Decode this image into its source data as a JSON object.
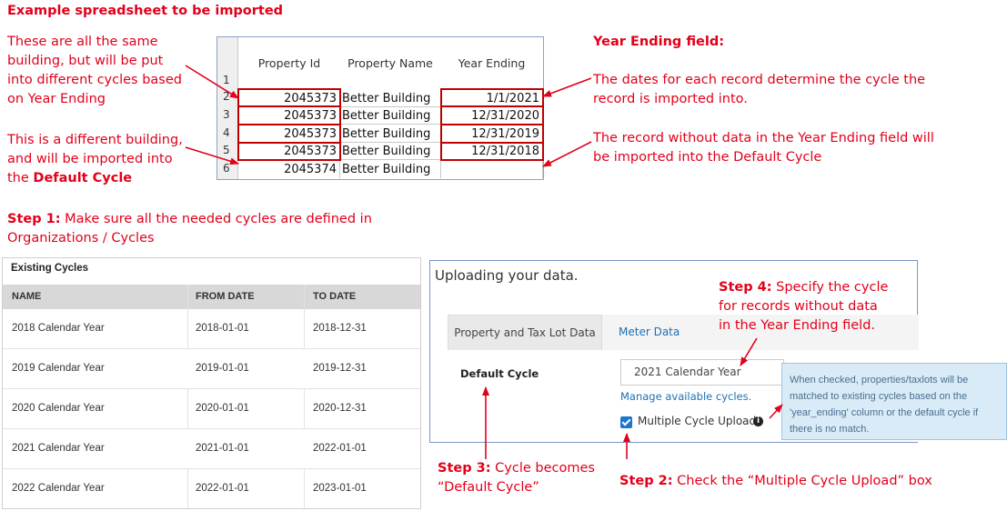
{
  "heading": "Example spreadsheet to be imported",
  "notes": {
    "same_building": [
      "These are all the same",
      "building, but will be put",
      "into different cycles based",
      "on Year Ending"
    ],
    "different_building": [
      "This is a different building,",
      "and will be imported into",
      "the "
    ],
    "different_building_bold": "Default Cycle",
    "year_ending_title": "Year Ending field:",
    "year_ending_body": [
      "The dates for each record determine the cycle the",
      "record is imported into."
    ],
    "no_data": [
      "The record without data in the Year Ending field will",
      "be imported into the Default Cycle"
    ]
  },
  "sheet": {
    "headers": [
      "Property Id",
      "Property Name",
      "Year Ending"
    ],
    "row_numbers": [
      "1",
      "2",
      "3",
      "4",
      "5",
      "6"
    ],
    "rows": [
      {
        "id": "2045373",
        "name": "Better Building",
        "year": "1/1/2021"
      },
      {
        "id": "2045373",
        "name": "Better Building",
        "year": "12/31/2020"
      },
      {
        "id": "2045373",
        "name": "Better Building",
        "year": "12/31/2019"
      },
      {
        "id": "2045373",
        "name": "Better Building",
        "year": "12/31/2018"
      },
      {
        "id": "2045374",
        "name": "Better Building",
        "year": ""
      }
    ]
  },
  "step1": {
    "bold": "Step 1:",
    "text": " Make sure all the needed cycles are defined in",
    "line2": "Organizations / Cycles"
  },
  "cycles": {
    "title": "Existing Cycles",
    "headers": [
      "NAME",
      "FROM DATE",
      "TO DATE"
    ],
    "rows": [
      {
        "name": "2018 Calendar Year",
        "from": "2018-01-01",
        "to": "2018-12-31"
      },
      {
        "name": "2019 Calendar Year",
        "from": "2019-01-01",
        "to": "2019-12-31"
      },
      {
        "name": "2020 Calendar Year",
        "from": "2020-01-01",
        "to": "2020-12-31"
      },
      {
        "name": "2021 Calendar Year",
        "from": "2021-01-01",
        "to": "2022-01-01"
      },
      {
        "name": "2022 Calendar Year",
        "from": "2022-01-01",
        "to": "2023-01-01"
      }
    ]
  },
  "upload": {
    "title": "Uploading your data.",
    "tab_active": "Property and Tax Lot Data",
    "tab_other": "Meter Data",
    "default_cycle_label": "Default Cycle",
    "selected_cycle": "2021 Calendar Year",
    "manage_link": "Manage available cycles.",
    "multi_label": "Multiple Cycle Upload",
    "info_icon": "i"
  },
  "tooltip": "When checked, properties/taxlots will be matched to existing cycles based on the 'year_ending' column or the default cycle if there is no match.",
  "step2": {
    "bold": "Step 2:",
    "text": " Check the “Multiple Cycle Upload” box"
  },
  "step3": {
    "bold": "Step 3:",
    "text": " Cycle becomes",
    "line2": "“Default Cycle”"
  },
  "step4": {
    "bold": "Step 4:",
    "text": " Specify the cycle",
    "line2": "for records without data",
    "line3": "in the Year Ending field."
  },
  "colors": {
    "annotation": "#e2001a",
    "link": "#1f6fb5",
    "checkbox": "#1976d2"
  }
}
